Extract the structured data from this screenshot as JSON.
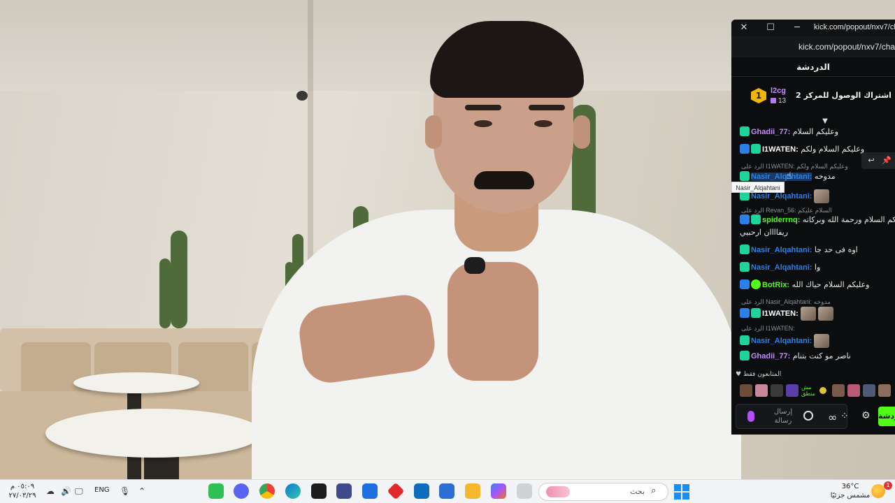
{
  "chat_window": {
    "title": "kick.com/popout/nxv7/ch",
    "url": "kick.com/popout/nxv7/cha",
    "header": "الدردشة",
    "pinned": {
      "rank": "1",
      "gifter": "l2cg",
      "gift_count": "13",
      "text": "إهداء 1 اشتراك الوصول للمركز 2"
    },
    "messages": [
      {
        "user": "Ghadii_77:",
        "text": "وعليكم السلام",
        "color": "#c58cff"
      },
      {
        "user": "I1WATEN:",
        "text": "وعليكم السلام ولكم",
        "color": "#ffffff"
      },
      {
        "reply": "الرد على I1WATEN: وعليكم السلام ولكم"
      },
      {
        "user": "Nasir_Alqahtani:",
        "text": "مدوخه",
        "color": "#2b80e8"
      },
      {
        "user": "Nasir_Alqahtani:",
        "text": "",
        "color": "#2b80e8"
      },
      {
        "reply": "الرد على Revan_56: السلام عليكم"
      },
      {
        "user": "spiderrnq:",
        "text": "وعليكم السلام ورحمة الله وبركاته",
        "color": "#53fc18"
      },
      {
        "cont": "ريفاااان ارحبيي"
      },
      {
        "user": "Nasir_Alqahtani:",
        "text": "اوه فى حد جا",
        "color": "#2b80e8"
      },
      {
        "user": "Nasir_Alqahtani:",
        "text": "وا",
        "color": "#2b80e8"
      },
      {
        "user": "BotRix:",
        "text": "وعليكم السلام حياك الله",
        "color": "#53fc18"
      },
      {
        "reply": "الرد على Nasir_Alqahtani: مدوخه"
      },
      {
        "user": "I1WATEN:",
        "text": "",
        "color": "#ffffff"
      },
      {
        "reply": "الرد على I1WATEN:"
      },
      {
        "user": "Nasir_Alqahtani:",
        "text": "",
        "color": "#2b80e8"
      },
      {
        "user": "Ghadii_77:",
        "text": "ناصر مو كنت بتنام",
        "color": "#c58cff"
      }
    ],
    "tooltip": "Nasir_Alqahtani",
    "watching_label": "المتابعون فقط",
    "avatar_label": "مش منطق",
    "composer_placeholder": "إرسال رسالة",
    "send_label": "دردشة"
  },
  "taskbar": {
    "time": "٠٥:٠٩ م",
    "date": "٢٧/٠٣/٢٩",
    "language": "ENG",
    "search_placeholder": "بحث",
    "temperature": "36°C",
    "weather": "مشمس جزئيًا",
    "notification_count": "1"
  },
  "colors": {
    "kick_green": "#53fc18",
    "chat_bg": "#0b0d0e",
    "taskbar_bg": "#f3f4f6"
  }
}
